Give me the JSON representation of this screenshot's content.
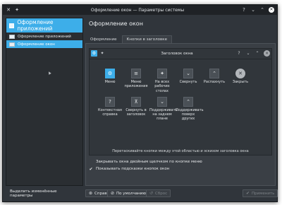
{
  "window": {
    "title": "Оформление окон — Параметры системы"
  },
  "sidebar": {
    "header_label": "Оформление приложений",
    "items": [
      {
        "label": "Оформление приложений",
        "active": false
      },
      {
        "label": "Оформление окон",
        "active": true
      }
    ]
  },
  "page": {
    "heading": "Оформление окон",
    "tabs": [
      {
        "label": "Оформление",
        "active": false
      },
      {
        "label": "Кнопки в заголовке",
        "active": true
      }
    ]
  },
  "preview": {
    "title": "Заголовок окна"
  },
  "buttons": [
    {
      "label": "Меню",
      "icon": "menu",
      "glyph": "⚙",
      "style": "blue"
    },
    {
      "label": "Меню приложения",
      "icon": "hamburger",
      "glyph": "≡",
      "style": ""
    },
    {
      "label": "На всех рабочих столах",
      "icon": "pin",
      "glyph": "✦",
      "style": ""
    },
    {
      "label": "Свернуть",
      "icon": "minimize",
      "glyph": "⌄",
      "style": ""
    },
    {
      "label": "Распахнуть",
      "icon": "maximize",
      "glyph": "⌃",
      "style": ""
    },
    {
      "label": "Закрыть",
      "icon": "close",
      "glyph": "✕",
      "style": "round"
    },
    {
      "label": "Контекстная справка",
      "icon": "help",
      "glyph": "?",
      "style": ""
    },
    {
      "label": "Свернуть в заголовок",
      "icon": "shade",
      "glyph": "⊼",
      "style": ""
    },
    {
      "label": "Поддерживать на заднем плане",
      "icon": "keep-below",
      "glyph": "⌄",
      "style": ""
    },
    {
      "label": "Поддерживать поверх других",
      "icon": "keep-above",
      "glyph": "⌃",
      "style": ""
    }
  ],
  "drag_hint": "Перетаскивайте кнопки между этой областью и эскизом заголовка окна",
  "options": [
    {
      "label": "Закрывать окна двойным щелчком по кнопке меню",
      "checked": false
    },
    {
      "label": "Показывать подсказки кнопок окон",
      "checked": true
    }
  ],
  "footer": {
    "highlight_label": "Выделить изменённые параметры",
    "help_label": "Справка",
    "defaults_label": "По умолчанию",
    "reset_label": "Сброс",
    "apply_label": "Применить"
  },
  "colors": {
    "accent": "#3daee9",
    "window_bg": "#30353b",
    "titlebar_bg": "#1f2226"
  }
}
